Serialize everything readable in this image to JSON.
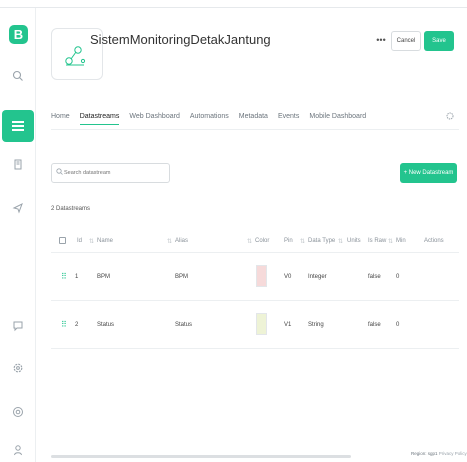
{
  "sidebar": {
    "logo": "B",
    "icons": [
      "search-icon",
      "dashboard-grid-icon",
      "devices-icon",
      "send-icon",
      "chat-icon",
      "settings-icon",
      "help-icon",
      "user-icon"
    ]
  },
  "header": {
    "title": "SistemMonitoringDetakJantung",
    "more_label": "•••",
    "cancel_label": "Cancel",
    "save_label": "Save"
  },
  "tabs": [
    "Home",
    "Datastreams",
    "Web Dashboard",
    "Automations",
    "Metadata",
    "Events",
    "Mobile Dashboard"
  ],
  "active_tab": "Datastreams",
  "toolbar": {
    "search_placeholder": "Search datastream",
    "new_label": "+ New Datastream"
  },
  "datastreams": {
    "count_label": "2 Datastreams",
    "columns": [
      "Id",
      "Name",
      "Alias",
      "Color",
      "Pin",
      "Data Type",
      "Units",
      "Is Raw",
      "Min",
      "Actions"
    ],
    "rows": [
      {
        "id": "1",
        "name": "BPM",
        "alias": "BPM",
        "color": "#f6dada",
        "pin": "V0",
        "data_type": "Integer",
        "units": "",
        "is_raw": "false",
        "min": "0"
      },
      {
        "id": "2",
        "name": "Status",
        "alias": "Status",
        "color": "#eef3d6",
        "pin": "V1",
        "data_type": "String",
        "units": "",
        "is_raw": "false",
        "min": "0"
      }
    ]
  },
  "footer": {
    "region": "Region: sgp1",
    "privacy": "Privacy Policy"
  },
  "colors": {
    "accent": "#23c48e",
    "border": "#e3e6e9"
  }
}
